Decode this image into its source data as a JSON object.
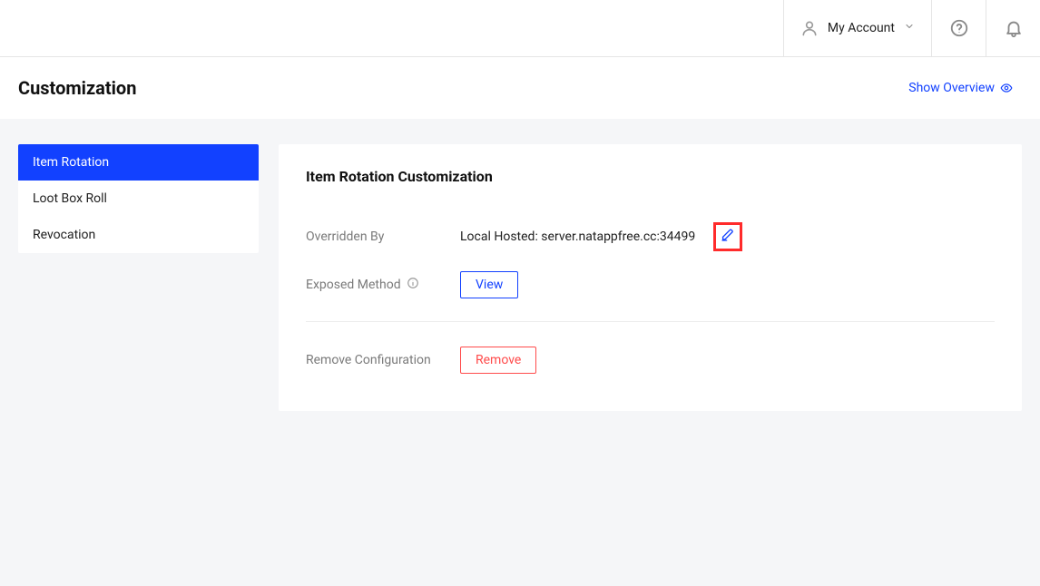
{
  "header": {
    "account_label": "My Account"
  },
  "page": {
    "title": "Customization",
    "show_overview_label": "Show Overview"
  },
  "sidebar": {
    "items": [
      {
        "label": "Item Rotation",
        "active": true
      },
      {
        "label": "Loot Box Roll",
        "active": false
      },
      {
        "label": "Revocation",
        "active": false
      }
    ]
  },
  "panel": {
    "title": "Item Rotation Customization",
    "overridden_by_label": "Overridden By",
    "overridden_by_value": "Local Hosted: server.natappfree.cc:34499",
    "exposed_method_label": "Exposed Method",
    "view_button": "View",
    "remove_config_label": "Remove Configuration",
    "remove_button": "Remove"
  },
  "colors": {
    "primary": "#1241ff",
    "danger": "#ff4b4b",
    "highlight_border": "#ff2b2b"
  }
}
